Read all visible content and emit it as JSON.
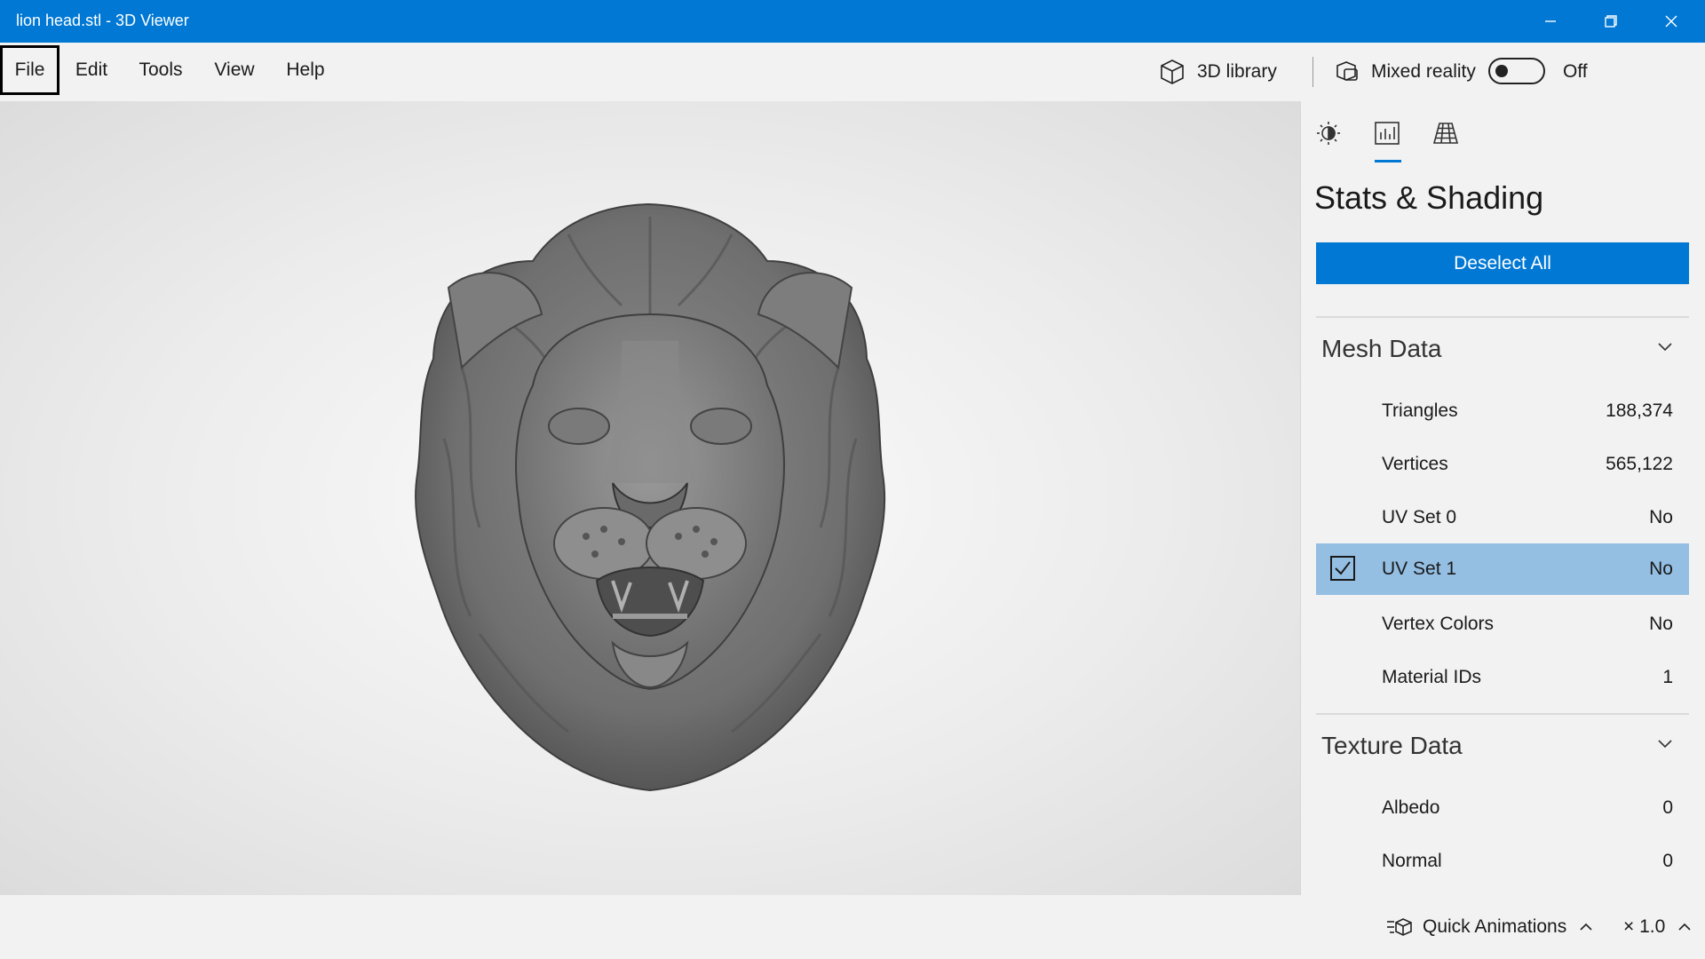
{
  "window": {
    "title": "lion head.stl - 3D Viewer"
  },
  "menu": {
    "items": [
      "File",
      "Edit",
      "Tools",
      "View",
      "Help"
    ]
  },
  "toolbar": {
    "library_label": "3D library",
    "mixed_reality_label": "Mixed reality",
    "mixed_reality_state": "Off"
  },
  "panel": {
    "title": "Stats & Shading",
    "tabs": [
      "lighting-icon",
      "stats-icon",
      "grid-icon"
    ],
    "deselect_label": "Deselect All",
    "mesh": {
      "title": "Mesh Data",
      "rows": [
        {
          "label": "Triangles",
          "value": "188,374"
        },
        {
          "label": "Vertices",
          "value": "565,122"
        },
        {
          "label": "UV Set 0",
          "value": "No"
        },
        {
          "label": "UV Set 1",
          "value": "No"
        },
        {
          "label": "Vertex Colors",
          "value": "No"
        },
        {
          "label": "Material IDs",
          "value": "1"
        }
      ]
    },
    "texture": {
      "title": "Texture Data",
      "rows": [
        {
          "label": "Albedo",
          "value": "0"
        },
        {
          "label": "Normal",
          "value": "0"
        }
      ]
    }
  },
  "status": {
    "animations_label": "Quick Animations",
    "speed_label": "× 1.0"
  },
  "colors": {
    "accent": "#0078d4",
    "selected_row": "#94bfe3"
  }
}
